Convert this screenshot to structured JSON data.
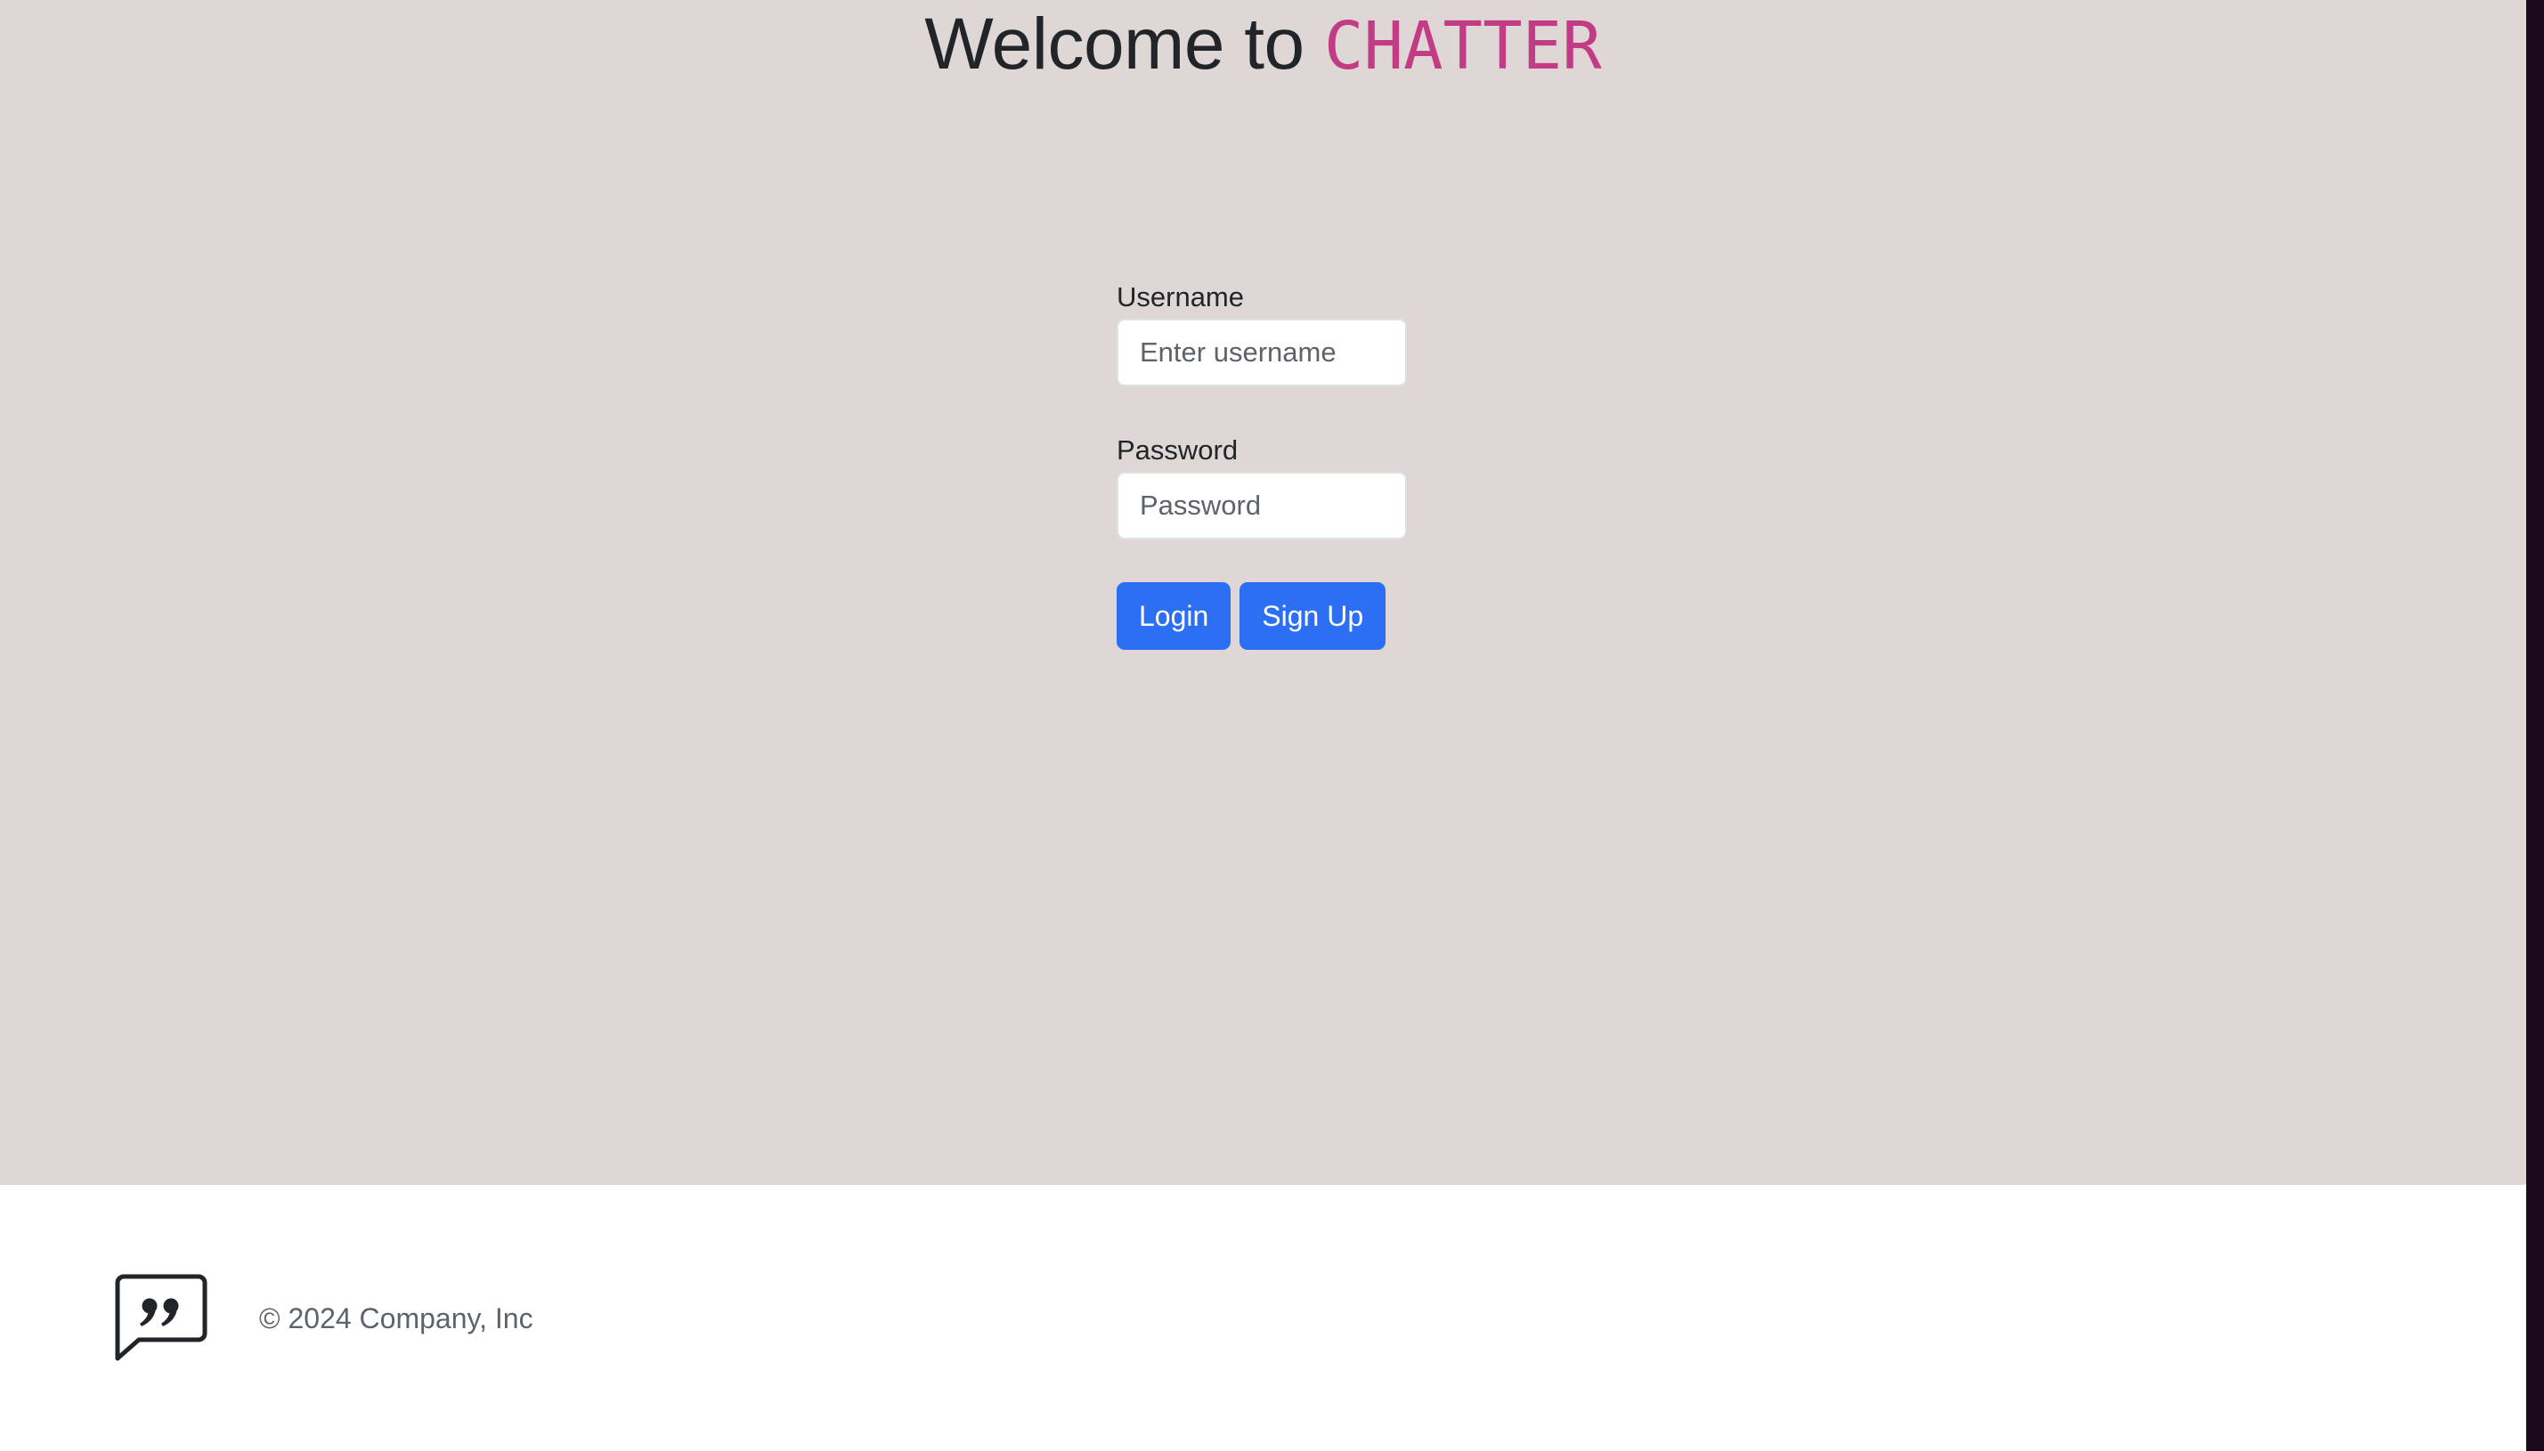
{
  "heading": {
    "prefix": "Welcome to ",
    "brand": "CHATTER"
  },
  "form": {
    "username_label": "Username",
    "username_placeholder": "Enter username",
    "username_value": "",
    "password_label": "Password",
    "password_placeholder": "Password",
    "password_value": "",
    "login_label": "Login",
    "signup_label": "Sign Up"
  },
  "footer": {
    "logo_icon": "chat-quote-icon",
    "copyright": "© 2024 Company, Inc"
  },
  "colors": {
    "background": "#dfd6d6",
    "brand": "#c13c84",
    "primary_button": "#2c6ff2",
    "footer_background": "#ffffff"
  }
}
